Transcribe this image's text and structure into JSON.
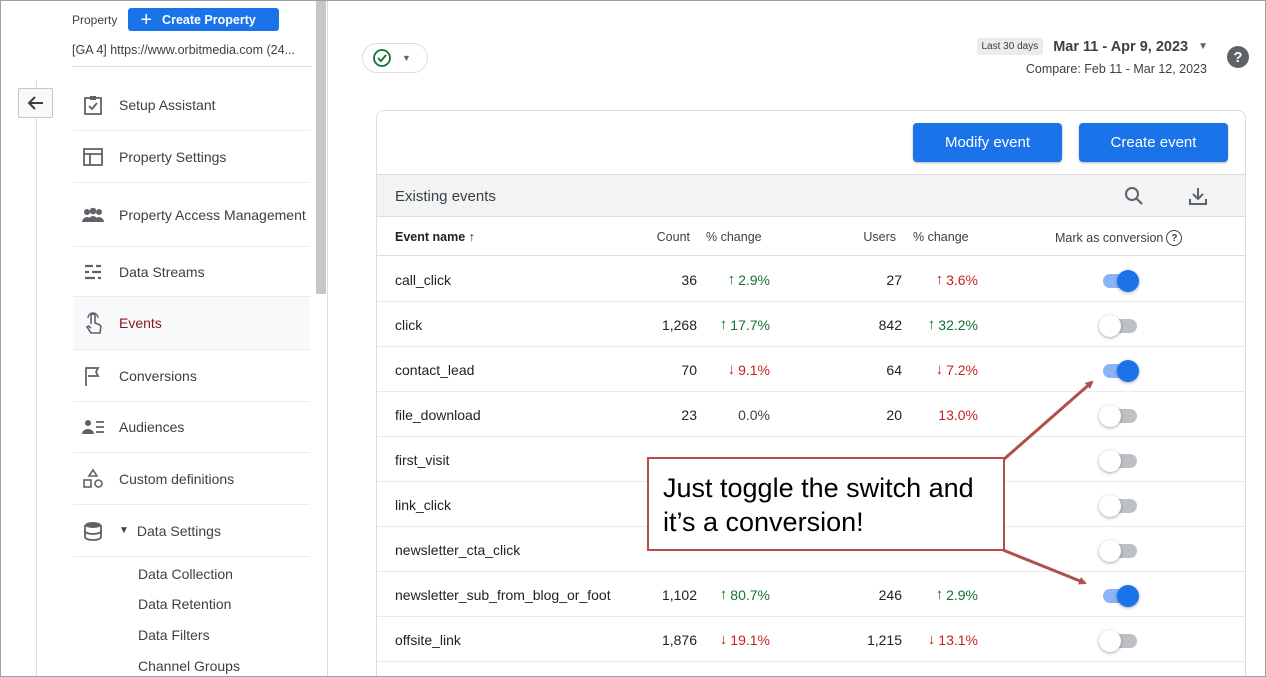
{
  "sidebar": {
    "property_label": "Property",
    "create_property_label": "Create Property",
    "property_name": "[GA 4] https://www.orbitmedia.com (24...",
    "nav": [
      {
        "label": "Setup Assistant",
        "icon": "setup-assistant-icon"
      },
      {
        "label": "Property Settings",
        "icon": "property-settings-icon"
      },
      {
        "label": "Property Access Management",
        "icon": "people-icon"
      },
      {
        "label": "Data Streams",
        "icon": "data-streams-icon"
      },
      {
        "label": "Events",
        "icon": "touch-icon",
        "active": true
      },
      {
        "label": "Conversions",
        "icon": "flag-icon"
      },
      {
        "label": "Audiences",
        "icon": "audiences-icon"
      },
      {
        "label": "Custom definitions",
        "icon": "shapes-icon"
      },
      {
        "label": "Data Settings",
        "icon": "database-icon"
      }
    ],
    "data_settings_sub": [
      "Data Collection",
      "Data Retention",
      "Data Filters",
      "Channel Groups"
    ]
  },
  "header": {
    "last_days_badge": "Last 30 days",
    "date_range": "Mar 11 - Apr 9, 2023",
    "compare": "Compare: Feb 11 - Mar 12, 2023",
    "help": "?"
  },
  "card": {
    "modify_event": "Modify event",
    "create_event": "Create event",
    "existing_events": "Existing events",
    "columns": {
      "event_name": "Event name",
      "count": "Count",
      "pct_change_1": "% change",
      "users": "Users",
      "pct_change_2": "% change",
      "mark_as_conversion": "Mark as conversion"
    },
    "rows": [
      {
        "name": "call_click",
        "count": "36",
        "pc1": "2.9%",
        "pc1_dir": "up",
        "users": "27",
        "pc2": "3.6%",
        "pc2_dir": "down-red-up",
        "conversion": true
      },
      {
        "name": "click",
        "count": "1,268",
        "pc1": "17.7%",
        "pc1_dir": "up",
        "users": "842",
        "pc2": "32.2%",
        "pc2_dir": "up",
        "conversion": false
      },
      {
        "name": "contact_lead",
        "count": "70",
        "pc1": "9.1%",
        "pc1_dir": "down",
        "users": "64",
        "pc2": "7.2%",
        "pc2_dir": "down",
        "conversion": true
      },
      {
        "name": "file_download",
        "count": "23",
        "pc1": "0.0%",
        "pc1_dir": "none",
        "users": "20",
        "pc2": "13.0%",
        "pc2_dir": "none-red",
        "conversion": false
      },
      {
        "name": "first_visit",
        "count": "",
        "pc1": "",
        "pc1_dir": "none",
        "users": "",
        "pc2": "",
        "pc2_dir": "none",
        "conversion": false
      },
      {
        "name": "link_click",
        "count": "",
        "pc1": "",
        "pc1_dir": "none",
        "users": "",
        "pc2": "",
        "pc2_dir": "none",
        "conversion": false
      },
      {
        "name": "newsletter_cta_click",
        "count": "",
        "pc1": "",
        "pc1_dir": "none",
        "users": "",
        "pc2": "",
        "pc2_dir": "none",
        "conversion": false
      },
      {
        "name": "newsletter_sub_from_blog_or_foot",
        "count": "1,102",
        "pc1": "80.7%",
        "pc1_dir": "up",
        "users": "246",
        "pc2": "2.9%",
        "pc2_dir": "up",
        "conversion": true
      },
      {
        "name": "offsite_link",
        "count": "1,876",
        "pc1": "19.1%",
        "pc1_dir": "down",
        "users": "1,215",
        "pc2": "13.1%",
        "pc2_dir": "down",
        "conversion": false
      }
    ]
  },
  "callout": {
    "line1": "Just toggle the switch and",
    "line2": "it’s a conversion!"
  },
  "colors": {
    "accent": "#1a73e8",
    "up": "#137333",
    "down": "#c5221f",
    "callout_border": "#b0504a",
    "events_highlight": "#f8f3a8"
  }
}
